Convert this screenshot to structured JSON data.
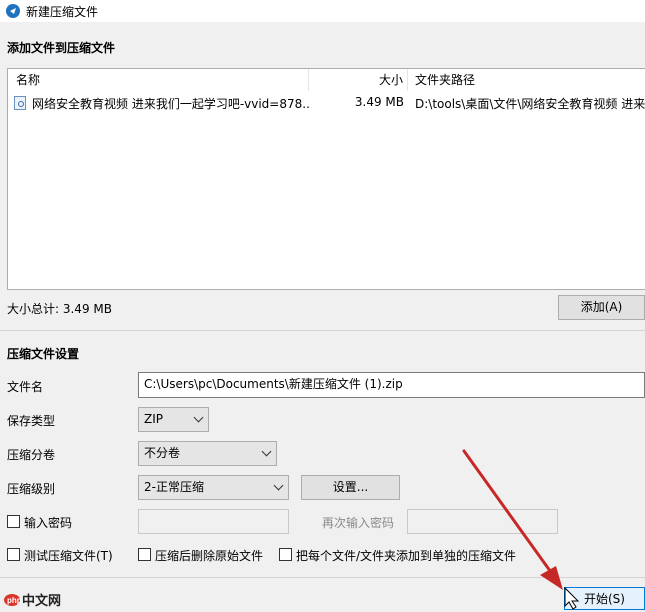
{
  "window": {
    "title": "新建压缩文件"
  },
  "add_section": {
    "title": "添加文件到压缩文件",
    "columns": {
      "name": "名称",
      "size": "大小",
      "path": "文件夹路径"
    },
    "files": [
      {
        "name": "网络安全教育视频 进来我们一起学习吧-vvid=878...",
        "size": "3.49 MB",
        "path": "D:\\tools\\桌面\\文件\\网络安全教育视频 进来"
      }
    ],
    "total_label": "大小总计: 3.49 MB",
    "add_button": "添加(A)"
  },
  "settings": {
    "title": "压缩文件设置",
    "filename_label": "文件名",
    "filename_value": "C:\\Users\\pc\\Documents\\新建压缩文件 (1).zip",
    "type_label": "保存类型",
    "type_value": "ZIP",
    "split_label": "压缩分卷",
    "split_value": "不分卷",
    "level_label": "压缩级别",
    "level_value": "2-正常压缩",
    "settings_button": "设置...",
    "password_label": "输入密码",
    "reenter_label": "再次输入密码",
    "test_label": "测试压缩文件(T)",
    "delete_label": "压缩后删除原始文件",
    "each_label": "把每个文件/文件夹添加到单独的压缩文件"
  },
  "footer": {
    "start_button": "开始(S)",
    "watermark": "php中文网"
  }
}
